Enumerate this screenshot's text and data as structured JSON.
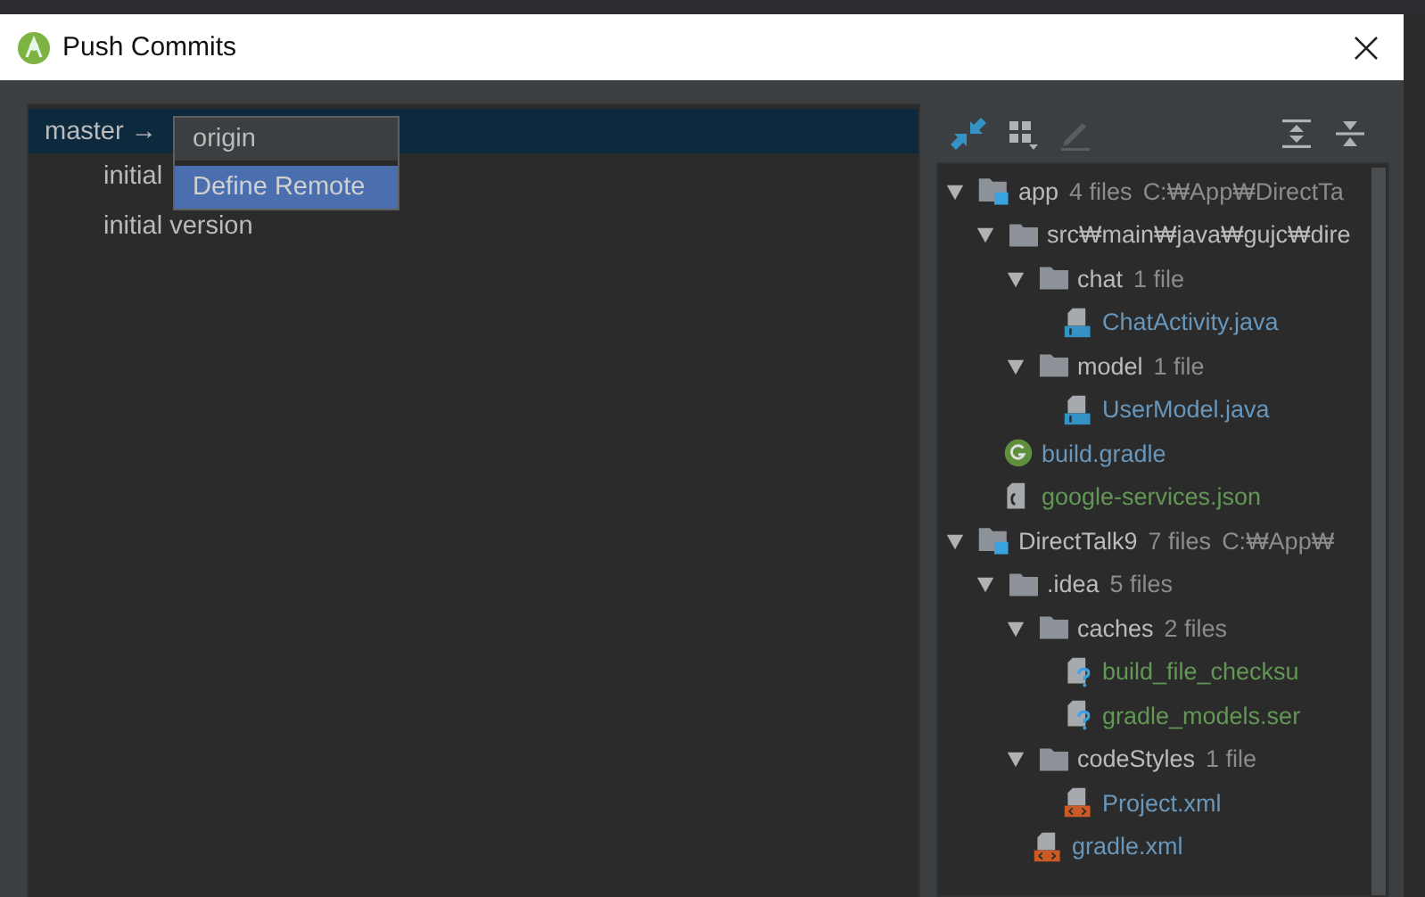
{
  "window": {
    "title": "Push Commits"
  },
  "branch": {
    "label": "master →",
    "commits": [
      {
        "message": "initial"
      },
      {
        "message": "initial version"
      }
    ]
  },
  "popup": {
    "items": [
      {
        "label": "origin",
        "selected": false
      },
      {
        "label": "Define Remote",
        "selected": true
      }
    ]
  },
  "toolbar": [
    {
      "kind": "collapse-arrows",
      "disabled": false
    },
    {
      "kind": "group",
      "disabled": false
    },
    {
      "kind": "edit",
      "disabled": true
    },
    {
      "kind": "expand-all",
      "disabled": false
    },
    {
      "kind": "collapse-all",
      "disabled": false
    }
  ],
  "tree": [
    {
      "kind": "module",
      "name": "app",
      "count": "4 files",
      "path": "C:₩App₩DirectTa",
      "expanded": true,
      "children": [
        {
          "kind": "folder",
          "name": "src₩main₩java₩gujc₩dire",
          "expanded": true,
          "children": [
            {
              "kind": "folder",
              "name": "chat",
              "count": "1 file",
              "expanded": true,
              "children": [
                {
                  "kind": "java",
                  "name": "ChatActivity.java",
                  "color": "#6897bb"
                }
              ]
            },
            {
              "kind": "folder",
              "name": "model",
              "count": "1 file",
              "expanded": true,
              "children": [
                {
                  "kind": "java",
                  "name": "UserModel.java",
                  "color": "#6897bb"
                }
              ]
            }
          ]
        },
        {
          "kind": "gradle",
          "name": "build.gradle",
          "color": "#6897bb"
        },
        {
          "kind": "json",
          "name": "google-services.json",
          "color": "#629755"
        }
      ]
    },
    {
      "kind": "module",
      "name": "DirectTalk9",
      "count": "7 files",
      "path": "C:₩App₩",
      "expanded": true,
      "children": [
        {
          "kind": "folder",
          "name": ".idea",
          "count": "5 files",
          "expanded": true,
          "children": [
            {
              "kind": "folder",
              "name": "caches",
              "count": "2 files",
              "expanded": true,
              "children": [
                {
                  "kind": "unknown",
                  "name": "build_file_checksu",
                  "color": "#629755"
                },
                {
                  "kind": "unknown",
                  "name": "gradle_models.ser",
                  "color": "#629755"
                }
              ]
            },
            {
              "kind": "folder",
              "name": "codeStyles",
              "count": "1 file",
              "expanded": true,
              "children": [
                {
                  "kind": "xml",
                  "name": "Project.xml",
                  "color": "#6897bb"
                }
              ]
            },
            {
              "kind": "xml",
              "name": "gradle.xml",
              "color": "#6897bb"
            }
          ]
        }
      ]
    }
  ]
}
